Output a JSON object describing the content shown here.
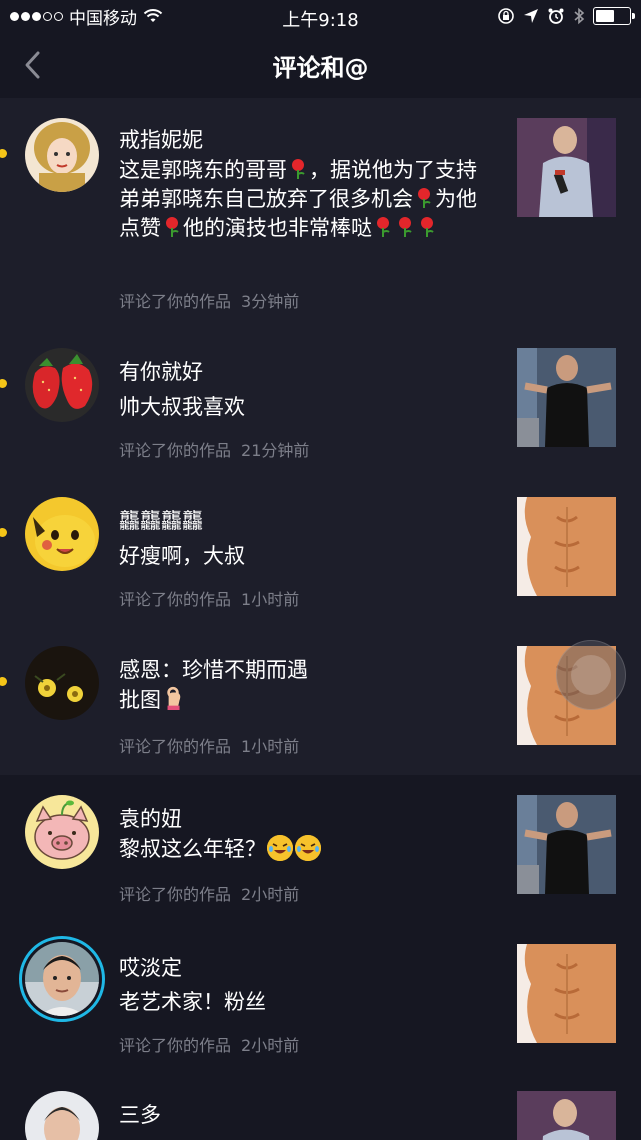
{
  "status_bar": {
    "carrier": "中国移动",
    "time": "上午9:18",
    "battery_level": 0.55
  },
  "nav": {
    "title": "评论和@",
    "back_icon": "chevron-left-icon"
  },
  "colors": {
    "background": "#161722",
    "unread_background": "#1d1e2a",
    "unread_dot": "#f5c518",
    "meta_text": "#7d7f8a",
    "avatar_ring": "#1fb8e6"
  },
  "notifications": [
    {
      "name": "戒指妮妮",
      "comment_parts": [
        "这是郭晓东的哥哥",
        "，据说他为了支持弟弟郭晓东自己放弃了很多机会",
        "为他点赞",
        "他的演技也非常棒哒"
      ],
      "action": "评论了你的作品",
      "time": "3分钟前",
      "unread": true
    },
    {
      "name": "有你就好",
      "comment": "帅大叔我喜欢",
      "action": "评论了你的作品",
      "time": "21分钟前",
      "unread": true
    },
    {
      "name": "龘龘龘龘",
      "comment": "好瘦啊，大叔",
      "action": "评论了你的作品",
      "time": "1小时前",
      "unread": true
    },
    {
      "name": "感恩：珍惜不期而遇",
      "comment": "批图",
      "action": "评论了你的作品",
      "time": "1小时前",
      "unread": true
    },
    {
      "name": "袁的妞",
      "comment": "黎叔这么年轻？",
      "action": "评论了你的作品",
      "time": "2小时前",
      "unread": false
    },
    {
      "name": "哎淡定",
      "comment": "老艺术家！粉丝",
      "action": "评论了你的作品",
      "time": "2小时前",
      "unread": false
    },
    {
      "name": "三多",
      "comment": "",
      "action": "",
      "time": "",
      "unread": false
    }
  ]
}
